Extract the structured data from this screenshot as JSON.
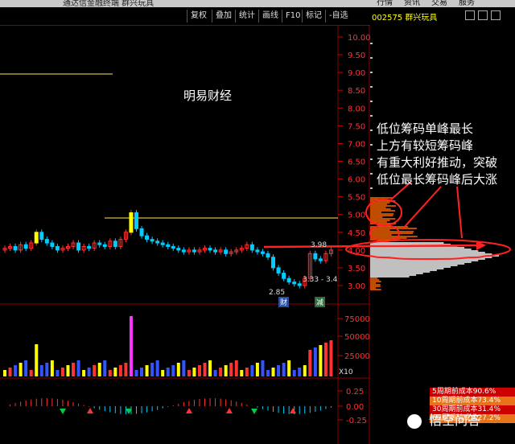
{
  "window": {
    "title": "通达信金融终端  群兴玩具",
    "top_menu": [
      "行情",
      "资讯",
      "交易",
      "服务"
    ]
  },
  "toolbar": {
    "buttons": [
      "复权",
      "叠加",
      "统计",
      "画线",
      "F10",
      "标记",
      "-自选"
    ],
    "nav_icons": [
      "back-icon",
      "forward-icon",
      "grid-icon"
    ]
  },
  "stock": {
    "code_name": "002575 群兴玩具"
  },
  "chart_data": {
    "type": "candlestick",
    "price_axis": {
      "ylim": [
        2.5,
        10.25
      ],
      "ticks": [
        3.0,
        3.5,
        4.0,
        4.5,
        5.0,
        5.5,
        6.0,
        6.5,
        7.0,
        7.5,
        8.0,
        8.5,
        9.0,
        9.5,
        10.0
      ]
    },
    "volume_axis": {
      "ticks": [
        25000,
        50000,
        75000
      ],
      "unit_label": "X10"
    },
    "macd_axis": {
      "ticks": [
        -0.25,
        0.0,
        0.25
      ]
    },
    "highlight_price_tags": [
      "3.98",
      "3.33 - 3.4",
      "2.85"
    ],
    "event_tags": [
      "财",
      "减"
    ],
    "candles_approx": [
      4.05,
      4.1,
      4.0,
      4.15,
      4.05,
      4.2,
      4.5,
      4.3,
      4.2,
      4.1,
      4.0,
      4.05,
      4.1,
      4.2,
      4.0,
      4.1,
      4.05,
      4.2,
      4.15,
      4.1,
      4.25,
      4.1,
      4.3,
      4.5,
      5.05,
      4.6,
      4.4,
      4.3,
      4.25,
      4.2,
      4.15,
      4.1,
      4.05,
      4.0,
      3.95,
      4.0,
      3.95,
      4.0,
      4.05,
      4.0,
      3.95,
      4.0,
      3.9,
      3.95,
      4.0,
      4.05,
      4.15,
      4.0,
      3.95,
      3.9,
      3.8,
      3.5,
      3.35,
      3.2,
      3.1,
      3.05,
      3.0,
      3.2,
      3.9,
      3.75,
      3.7,
      3.9,
      4.0
    ]
  },
  "annotations": {
    "watermark_text": "明易财经",
    "lines": [
      "低位筹码单峰最长",
      "上方有较短筹码峰",
      "有重大利好推动，突破",
      "低位最长筹码峰后大涨"
    ]
  },
  "cost_panel": {
    "rows": [
      {
        "label": "5周期前成本90.6%",
        "bg": "#cc0000"
      },
      {
        "label": "10周期前成本73.4%",
        "bg": "#e8741a"
      },
      {
        "label": "30周期前成本31.4%",
        "bg": "#cc0000"
      },
      {
        "label": "60周期前成本27.2%",
        "bg": "#e8741a"
      }
    ]
  },
  "footer_badge": {
    "text": "悟空问答"
  },
  "colors": {
    "up": "#ff3333",
    "down": "#00ccff",
    "accent": "#ffff00",
    "magenta": "#ff33ff"
  }
}
